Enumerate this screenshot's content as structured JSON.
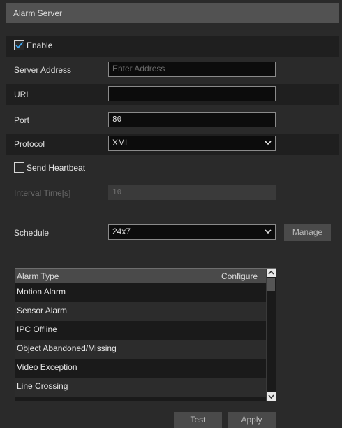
{
  "window": {
    "title": "Alarm Server"
  },
  "form": {
    "enable": {
      "label": "Enable",
      "checked": true
    },
    "server_address": {
      "label": "Server Address",
      "value": "",
      "placeholder": "Enter Address"
    },
    "url": {
      "label": "URL",
      "value": ""
    },
    "port": {
      "label": "Port",
      "value": "80"
    },
    "protocol": {
      "label": "Protocol",
      "value": "XML"
    },
    "send_heartbeat": {
      "label": "Send Heartbeat",
      "checked": false
    },
    "interval_time": {
      "label": "Interval Time[s]",
      "value": "10"
    },
    "schedule": {
      "label": "Schedule",
      "value": "24x7",
      "manage_label": "Manage"
    }
  },
  "alarm_table": {
    "columns": [
      "Alarm Type",
      "Configure"
    ],
    "rows": [
      "Motion Alarm",
      "Sensor Alarm",
      "IPC Offline",
      "Object Abandoned/Missing",
      "Video Exception",
      "Line Crossing"
    ]
  },
  "buttons": {
    "test": "Test",
    "apply": "Apply"
  },
  "colors": {
    "accent": "#3fa9f5",
    "background": "#2a2a2a",
    "row_dark": "#1f1f1f",
    "header": "#525252"
  },
  "icons": [
    "checkbox-checked-icon",
    "checkbox-empty-icon",
    "chevron-down-icon",
    "scroll-up-icon",
    "scroll-down-icon"
  ]
}
